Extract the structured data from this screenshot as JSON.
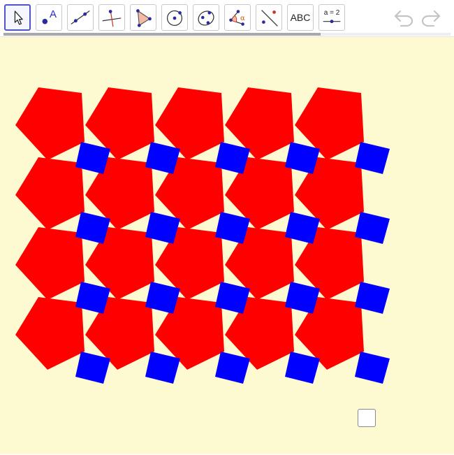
{
  "toolbar": {
    "tools": [
      {
        "name": "move-tool",
        "icon": "arrow-cursor-icon",
        "selected": true
      },
      {
        "name": "point-tool",
        "icon": "point-icon",
        "label": "A"
      },
      {
        "name": "line-tool",
        "icon": "line-through-points-icon"
      },
      {
        "name": "perpendicular-line-tool",
        "icon": "perpendicular-line-icon"
      },
      {
        "name": "polygon-tool",
        "icon": "polygon-icon"
      },
      {
        "name": "circle-tool",
        "icon": "circle-center-point-icon"
      },
      {
        "name": "conic-tool",
        "icon": "ellipse-icon"
      },
      {
        "name": "angle-tool",
        "icon": "angle-icon",
        "label": "α"
      },
      {
        "name": "reflect-tool",
        "icon": "reflect-about-line-icon"
      },
      {
        "name": "text-tool",
        "icon": "text-icon",
        "label": "ABC"
      },
      {
        "name": "slider-tool",
        "icon": "slider-icon",
        "label": "a = 2"
      }
    ],
    "undo_icon": "undo-icon",
    "redo_icon": "redo-icon",
    "scroll_progress": 0.71
  },
  "colors": {
    "accent": "#4f55c8",
    "canvas_bg": "#fdf9d1",
    "pentagon": "#ff0000",
    "square": "#0000ff"
  },
  "tiling": {
    "columns": 5,
    "rows": 4,
    "shapes": [
      "pentagon",
      "square"
    ]
  },
  "checkbox": {
    "checked": false
  }
}
